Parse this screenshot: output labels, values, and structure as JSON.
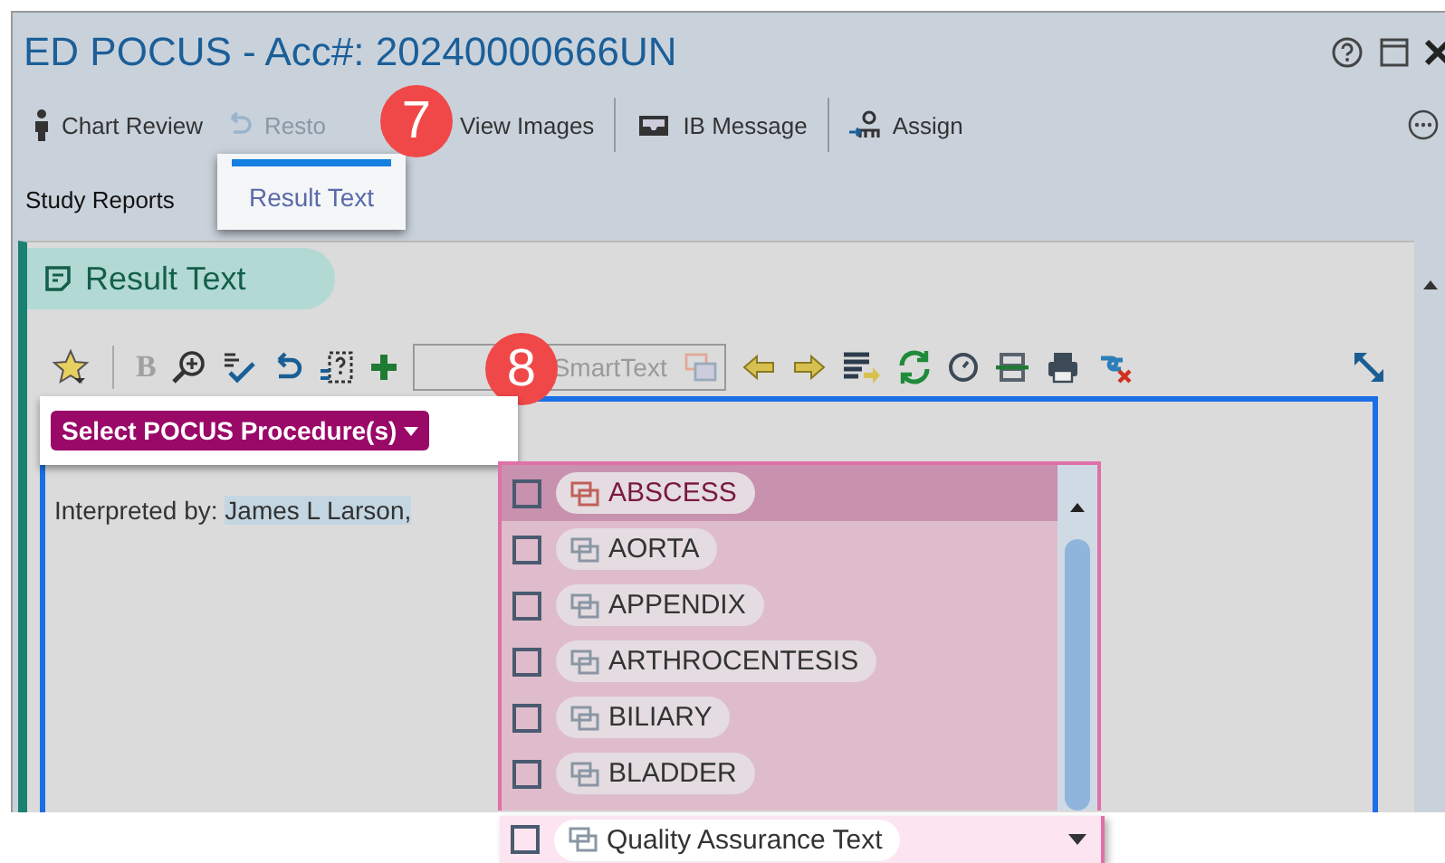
{
  "window": {
    "title": "ED POCUS - Acc#: 20240000666UN"
  },
  "toolbar": {
    "groups": [
      [
        {
          "kind": "person",
          "label": "Chart Review",
          "disabled": false
        },
        {
          "kind": "restore",
          "label": "Resto",
          "disabled": true
        },
        {
          "kind": "images",
          "label": "View Images",
          "disabled": false
        }
      ],
      [
        {
          "kind": "message",
          "label": "IB Message",
          "disabled": false
        }
      ],
      [
        {
          "kind": "assign",
          "label": "Assign",
          "disabled": false
        }
      ]
    ]
  },
  "section_tab": {
    "label": "Study Reports",
    "selected": true
  },
  "popup_tab": {
    "label": "Result Text",
    "selected": true
  },
  "callouts": [
    {
      "number": "7"
    },
    {
      "number": "8"
    }
  ],
  "panel": {
    "title": "Result Text"
  },
  "editor_toolbar": {
    "bold_label": "B",
    "bold_disabled": true,
    "smarttext_placeholder": "SmartText"
  },
  "procedure_button": {
    "label": "Select POCUS Procedure(s)"
  },
  "note": {
    "label": "Interpreted by:",
    "name": "James L Larson,"
  },
  "procedures": [
    {
      "label": "ABSCESS",
      "checked": false,
      "selected": true
    },
    {
      "label": "AORTA",
      "checked": false,
      "selected": false
    },
    {
      "label": "APPENDIX",
      "checked": false,
      "selected": false
    },
    {
      "label": "ARTHROCENTESIS",
      "checked": false,
      "selected": false
    },
    {
      "label": "BILIARY",
      "checked": false,
      "selected": false
    },
    {
      "label": "BLADDER",
      "checked": false,
      "selected": false
    }
  ],
  "footer_option": {
    "label": "Quality Assurance Text",
    "checked": false
  }
}
